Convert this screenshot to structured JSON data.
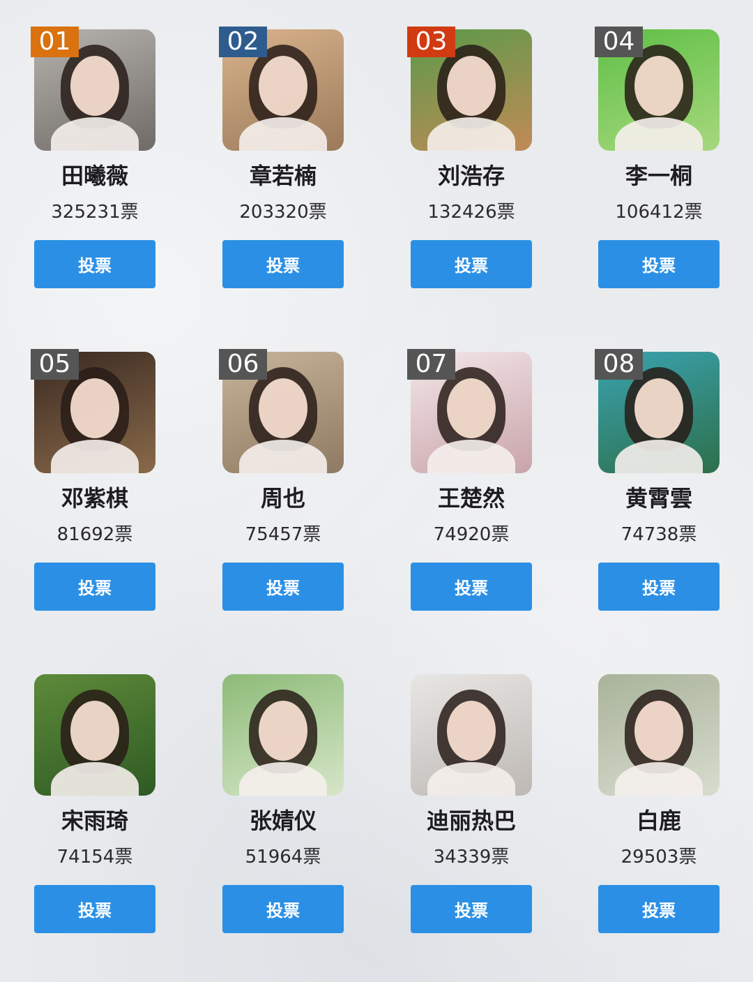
{
  "vote_label": "投票",
  "colors": {
    "button": "#2b90e5",
    "rank_gold": "#d9720f",
    "rank_blue": "#2f5c8e",
    "rank_red": "#d23a12",
    "rank_gray": "#555555"
  },
  "contestants": [
    {
      "rank": "01",
      "name": "田曦薇",
      "votes": "325231票",
      "rank_color": "#d9720f",
      "photo_bg": [
        "#b7b4b0",
        "#6f6a66"
      ]
    },
    {
      "rank": "02",
      "name": "章若楠",
      "votes": "203320票",
      "rank_color": "#2f5c8e",
      "photo_bg": [
        "#d9b38c",
        "#9b7a5a"
      ]
    },
    {
      "rank": "03",
      "name": "刘浩存",
      "votes": "132426票",
      "rank_color": "#d23a12",
      "photo_bg": [
        "#5a9a4a",
        "#c28a56"
      ]
    },
    {
      "rank": "04",
      "name": "李一桐",
      "votes": "106412票",
      "rank_color": "#555555",
      "photo_bg": [
        "#5fbf46",
        "#a7d87e"
      ]
    },
    {
      "rank": "05",
      "name": "邓紫棋",
      "votes": "81692票",
      "rank_color": "#555555",
      "photo_bg": [
        "#3a2a22",
        "#8a6a4a"
      ]
    },
    {
      "rank": "06",
      "name": "周也",
      "votes": "75457票",
      "rank_color": "#555555",
      "photo_bg": [
        "#c8b49a",
        "#8e7a62"
      ]
    },
    {
      "rank": "07",
      "name": "王楚然",
      "votes": "74920票",
      "rank_color": "#555555",
      "photo_bg": [
        "#f3e6e8",
        "#c8a4aa"
      ]
    },
    {
      "rank": "08",
      "name": "黄霄雲",
      "votes": "74738票",
      "rank_color": "#555555",
      "photo_bg": [
        "#3aa3b0",
        "#2d6f4a"
      ]
    },
    {
      "rank": "",
      "name": "宋雨琦",
      "votes": "74154票",
      "rank_color": "",
      "photo_bg": [
        "#5d8a3a",
        "#2f5a24"
      ]
    },
    {
      "rank": "",
      "name": "张婧仪",
      "votes": "51964票",
      "rank_color": "",
      "photo_bg": [
        "#8dbb78",
        "#d6e6c8"
      ]
    },
    {
      "rank": "",
      "name": "迪丽热巴",
      "votes": "34339票",
      "rank_color": "",
      "photo_bg": [
        "#e8e6e4",
        "#bdb8b4"
      ]
    },
    {
      "rank": "",
      "name": "白鹿",
      "votes": "29503票",
      "rank_color": "",
      "photo_bg": [
        "#a9b39a",
        "#d8dccf"
      ]
    }
  ]
}
